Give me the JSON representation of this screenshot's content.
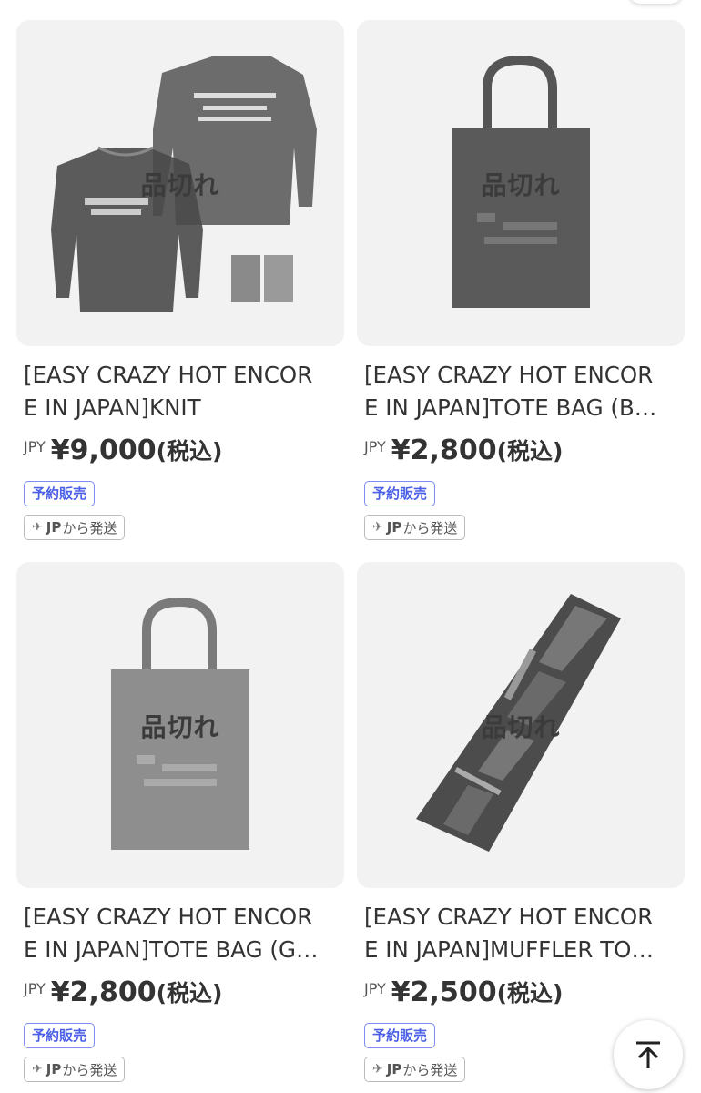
{
  "products": [
    {
      "soldout_label": "品切れ",
      "title_line1": "[EASY CRAZY HOT ENCOR",
      "title_line2": "E IN JAPAN]KNIT",
      "currency": "JPY",
      "price": "¥9,000",
      "tax": "(税込)",
      "badge_presale": "予約販売",
      "ship_jp": "JP",
      "ship_text": "から発送",
      "image": "knit"
    },
    {
      "soldout_label": "品切れ",
      "title_line1": "[EASY CRAZY HOT ENCOR",
      "title_line2": "E IN JAPAN]TOTE BAG (B…",
      "currency": "JPY",
      "price": "¥2,800",
      "tax": "(税込)",
      "badge_presale": "予約販売",
      "ship_jp": "JP",
      "ship_text": "から発送",
      "image": "tote-dark"
    },
    {
      "soldout_label": "品切れ",
      "title_line1": "[EASY CRAZY HOT ENCOR",
      "title_line2": "E IN JAPAN]TOTE BAG (G…",
      "currency": "JPY",
      "price": "¥2,800",
      "tax": "(税込)",
      "badge_presale": "予約販売",
      "ship_jp": "JP",
      "ship_text": "から発送",
      "image": "tote-grey"
    },
    {
      "soldout_label": "品切れ",
      "title_line1": "[EASY CRAZY HOT ENCOR",
      "title_line2": "E IN JAPAN]MUFFLER TO…",
      "currency": "JPY",
      "price": "¥2,500",
      "tax": "(税込)",
      "badge_presale": "予約販売",
      "ship_jp": "JP",
      "ship_text": "から発送",
      "image": "muffler"
    }
  ],
  "icons": {
    "plane": "airplane-icon",
    "top": "arrow-up-to-top-icon"
  },
  "colors": {
    "presale_border": "#7c8cf2",
    "presale_text": "#4a5fe6",
    "thumb_bg": "#f2f2f2"
  }
}
